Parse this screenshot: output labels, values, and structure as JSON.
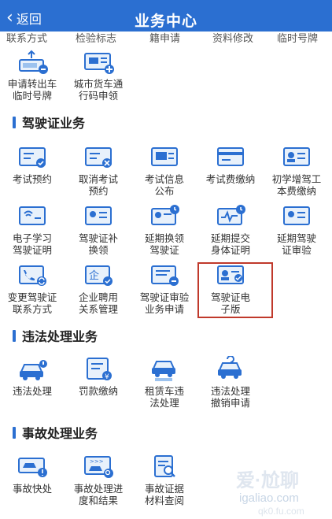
{
  "header": {
    "back_label": "返回",
    "title": "业务中心"
  },
  "cut_row": [
    "联系方式",
    "检验标志",
    "籍申请",
    "资料修改",
    "临时号牌"
  ],
  "sections": {
    "vehicle_tail": {
      "items": [
        {
          "label": "申请转出车\n临时号牌"
        },
        {
          "label": "城市货车通\n行码申领"
        }
      ]
    },
    "license": {
      "title": "驾驶证业务",
      "items": [
        {
          "label": "考试预约"
        },
        {
          "label": "取消考试\n预约"
        },
        {
          "label": "考试信息\n公布"
        },
        {
          "label": "考试费缴纳"
        },
        {
          "label": "初学增驾工\n本费缴纳"
        },
        {
          "label": "电子学习\n驾驶证明"
        },
        {
          "label": "驾驶证补\n换领"
        },
        {
          "label": "延期换领\n驾驶证"
        },
        {
          "label": "延期提交\n身体证明"
        },
        {
          "label": "延期驾驶\n证审验"
        },
        {
          "label": "变更驾驶证\n联系方式"
        },
        {
          "label": "企业聘用\n关系管理"
        },
        {
          "label": "驾驶证审验\n业务申请"
        },
        {
          "label": "驾驶证电\n子版"
        }
      ]
    },
    "violation": {
      "title": "违法处理业务",
      "items": [
        {
          "label": "违法处理"
        },
        {
          "label": "罚款缴纳"
        },
        {
          "label": "租赁车违\n法处理"
        },
        {
          "label": "违法处理\n撤销申请"
        }
      ]
    },
    "accident": {
      "title": "事故处理业务",
      "items": [
        {
          "label": "事故快处"
        },
        {
          "label": "事故处理进\n度和结果"
        },
        {
          "label": "事故证据\n材料查阅"
        }
      ]
    }
  },
  "watermark": {
    "line1": "爱·尬聊",
    "line2": "igaliao.com",
    "line3": "qk0.fu.com"
  },
  "colors": {
    "accent": "#2b6fd1",
    "highlight": "#c0392b"
  }
}
